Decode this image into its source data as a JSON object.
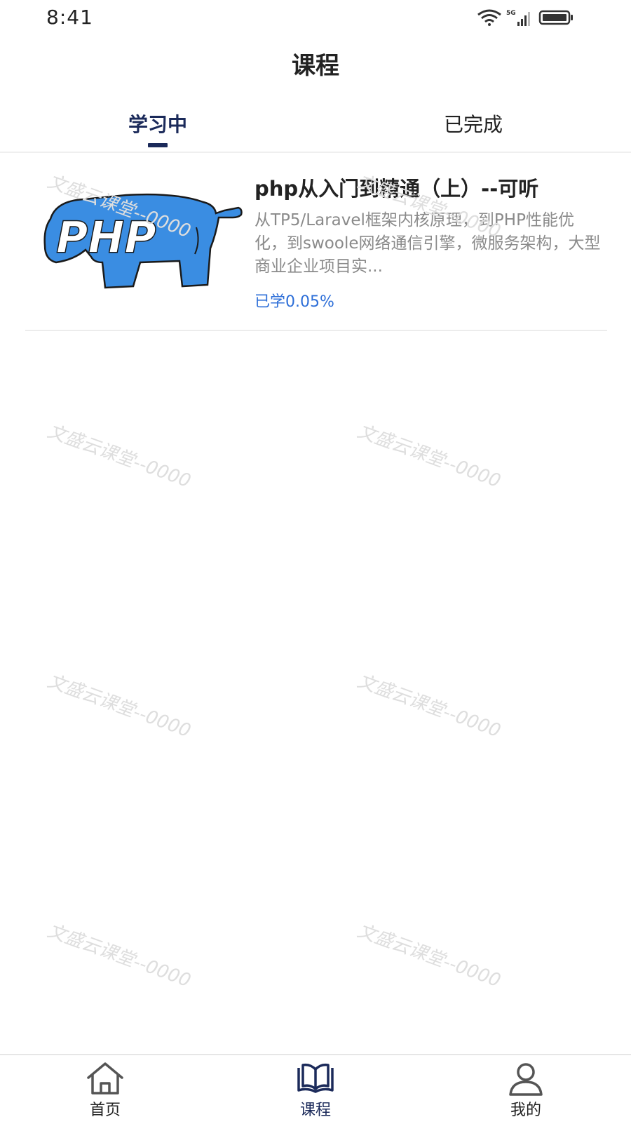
{
  "status_bar": {
    "time": "8:41",
    "network": "5G"
  },
  "header": {
    "title": "课程"
  },
  "tabs": [
    {
      "label": "学习中",
      "active": true
    },
    {
      "label": "已完成",
      "active": false
    }
  ],
  "courses": [
    {
      "thumbnail_text": "PHP",
      "title": "php从入门到精通（上）--可听",
      "description": "从TP5/Laravel框架内核原理，到PHP性能优化，到swoole网络通信引擎，微服务架构，大型商业企业项目实...",
      "progress": "已学0.05%"
    }
  ],
  "watermark": "文盛云课堂--0000",
  "bottom_nav": [
    {
      "label": "首页",
      "icon": "home-icon"
    },
    {
      "label": "课程",
      "icon": "book-icon",
      "active": true
    },
    {
      "label": "我的",
      "icon": "user-icon"
    }
  ],
  "colors": {
    "accent": "#1b2a5a",
    "progress": "#2e6fd8",
    "php_logo": "#3a8de2"
  }
}
